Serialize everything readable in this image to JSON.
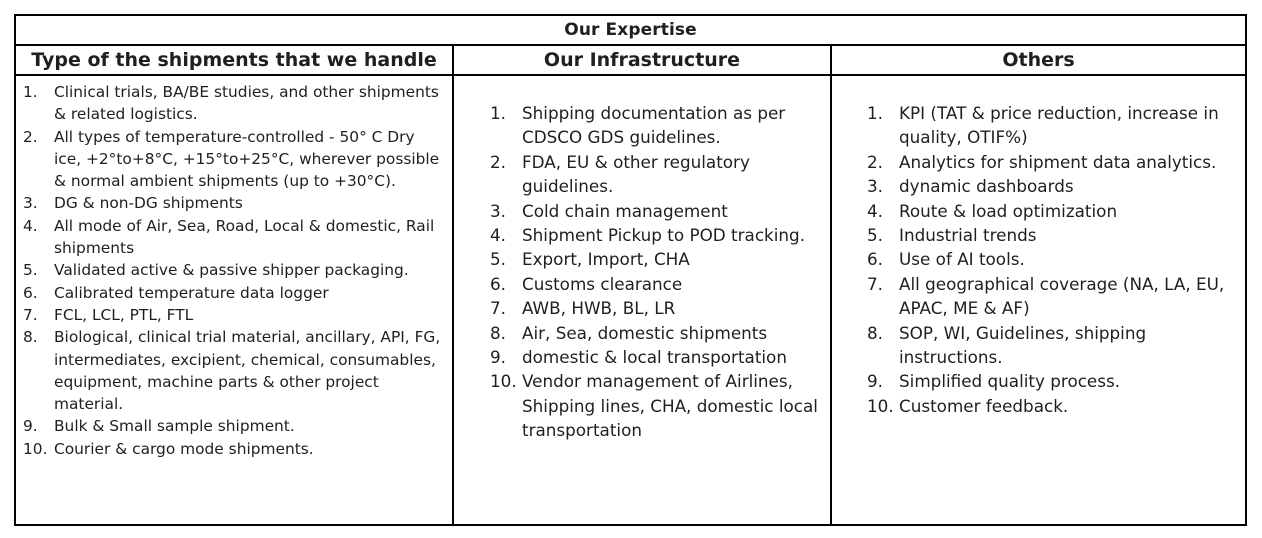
{
  "table": {
    "title": "Our Expertise",
    "columns": [
      {
        "heading": "Type of the shipments that we handle",
        "items": [
          "Clinical trials, BA/BE studies, and other shipments & related logistics.",
          "All types of temperature-controlled - 50° C Dry ice, +2°to+8°C, +15°to+25°C, wherever possible & normal ambient shipments (up to +30°C).",
          "DG & non-DG shipments",
          "All mode of Air, Sea, Road, Local & domestic, Rail shipments",
          "Validated active & passive shipper packaging.",
          "Calibrated temperature data logger",
          "FCL, LCL, PTL, FTL",
          "Biological, clinical trial material, ancillary, API, FG, intermediates, excipient, chemical, consumables, equipment, machine parts & other project material.",
          "Bulk & Small sample shipment.",
          "Courier & cargo mode shipments."
        ]
      },
      {
        "heading": "Our Infrastructure",
        "items": [
          "Shipping documentation as per CDSCO GDS guidelines.",
          "FDA, EU & other regulatory guidelines.",
          "Cold chain management",
          "Shipment Pickup to POD tracking.",
          "Export, Import, CHA",
          "Customs clearance",
          "AWB, HWB, BL, LR",
          "Air, Sea, domestic shipments",
          "domestic & local transportation",
          "Vendor management of Airlines, Shipping lines, CHA, domestic local transportation"
        ]
      },
      {
        "heading": "Others",
        "items": [
          "KPI (TAT & price reduction, increase in quality, OTIF%)",
          "Analytics for shipment data analytics.",
          "dynamic dashboards",
          "Route & load optimization",
          "Industrial trends",
          "Use of AI tools.",
          " All geographical coverage (NA, LA, EU, APAC, ME & AF)",
          "SOP, WI, Guidelines, shipping instructions.",
          "Simplified quality process.",
          "Customer feedback."
        ]
      }
    ]
  }
}
